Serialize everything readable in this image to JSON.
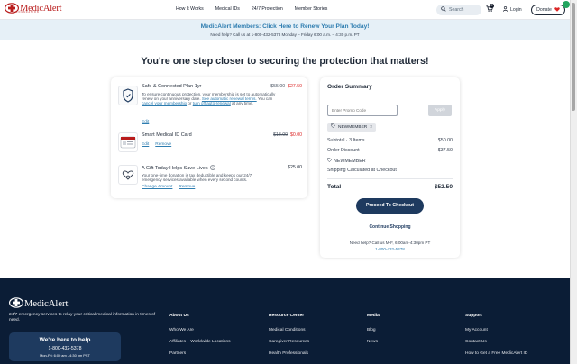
{
  "header": {
    "logo_text": "MedicAlert",
    "logo_sub": "FOUNDATION",
    "nav": [
      "How It Works",
      "Medical IDs",
      "24/7 Protection",
      "Member Stories"
    ],
    "search_placeholder": "Search",
    "cart_count": "0",
    "login": "Login",
    "donate": "Donate"
  },
  "banner": {
    "title": "MedicAlert Members: Click Here to Renew Your Plan Today!",
    "subtitle": "Need help? Call us at 1-800-432-5378 Monday – Friday 6:00 a.m. – 4:30 p.m. PT"
  },
  "main_title": "You're one step closer to securing the protection that matters!",
  "items": [
    {
      "name": "Safe & Connected Plan 1yr",
      "desc_1": "To ensure continuous protection, your membership is set to automatically renew on your anniversary date.",
      "desc_link_1": "See automatic renewal terms.",
      "desc_2": "You can",
      "desc_link_2": "cancel your membership",
      "desc_3": "or",
      "desc_link_3": "turn off auto-renewal",
      "desc_4": "at any time.",
      "old_price": "$55.00",
      "price": "$27.50",
      "action_edit": "Edit",
      "icon": "shield-icon"
    },
    {
      "name": "Smart Medical ID Card",
      "old_price": "$18.00",
      "price": "$0.00",
      "action_edit": "Edit",
      "action_remove": "Remove",
      "icon": "id-card-icon"
    },
    {
      "name": "A Gift Today Helps Save Lives",
      "desc_1": "Your one-time donation is tax deductible and keeps our 24/7 emergency services available when every second counts.",
      "price": "$25.00",
      "action_change": "Change Amount",
      "action_remove": "Remove",
      "icon": "gift-heart-icon"
    }
  ],
  "summary": {
    "title": "Order Summary",
    "promo_placeholder": "Enter Promo Code",
    "apply": "Apply",
    "promo_tag": "NEWMEMBER",
    "subtotal_label": "Subtotal · 3 Items",
    "subtotal_value": "$50.00",
    "discount_label": "Order Discount",
    "discount_value": "-$37.50",
    "coupon_code": "NEWMEMBER",
    "shipping_label": "Shipping Calculated at Checkout",
    "total_label": "Total",
    "total_value": "$52.50",
    "checkout": "Proceed To Checkout",
    "continue": "Continue Shopping",
    "help": "Need help? Call us M-F, 6:00am-4:30pm PT",
    "help_phone": "1-800-432-5378"
  },
  "footer": {
    "logo_text": "MedicAlert",
    "tagline": "24/7 emergency services to relay your critical medical information in times of need.",
    "help_title": "We're here to help",
    "help_phone": "1-800-432-5378",
    "help_hours": "Mon-Fri: 6:00 am - 4:30 pm PST",
    "columns": [
      {
        "heading": "About Us",
        "links": [
          "Who We Are",
          "Affiliates – Worldwide Locations",
          "Partners"
        ]
      },
      {
        "heading": "Resource Center",
        "links": [
          "Medical Conditions",
          "Caregiver Resources",
          "Health Professionals"
        ]
      },
      {
        "heading": "Media",
        "links": [
          "Blog",
          "News"
        ]
      },
      {
        "heading": "Support",
        "links": [
          "My Account",
          "Contact Us",
          "How to Get a Free MedicAlert ID"
        ]
      }
    ]
  },
  "colors": {
    "brand_red": "#b91c1c",
    "link_blue": "#2e7db0",
    "navy": "#1e3a5f",
    "footer_bg": "#0b1d36"
  }
}
